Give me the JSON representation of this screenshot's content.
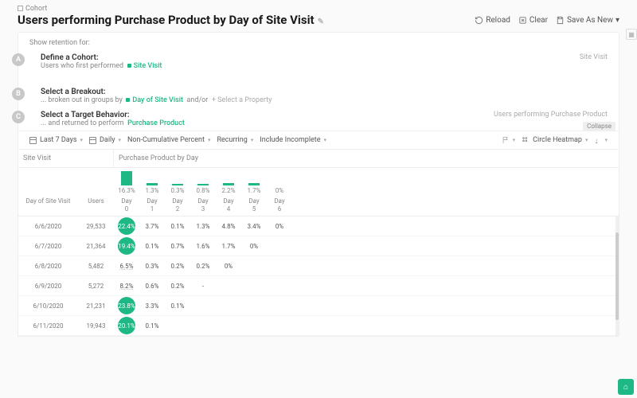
{
  "breadcrumb": {
    "icon": "cohort",
    "label": "Cohort"
  },
  "title": "Users performing Purchase Product by Day of Site Visit",
  "actions": {
    "reload": "Reload",
    "clear": "Clear",
    "save": "Save As New"
  },
  "retention_label": "Show retention for:",
  "steps": {
    "A": {
      "title": "Define a Cohort:",
      "desc": "Users who first performed",
      "token": "Site Visit",
      "right": "Site Visit"
    },
    "B": {
      "title": "Select a Breakout:",
      "prefix": "... broken out in groups by",
      "token": "Day of Site Visit",
      "mid": "and/or",
      "add": "+ Select a Property"
    },
    "C": {
      "title": "Select a Target Behavior:",
      "desc": "... and returned to perform",
      "token": "Purchase Product",
      "right": "Users performing Purchase Product"
    }
  },
  "controls": {
    "range": "Last 7 Days",
    "interval": "Daily",
    "mode": "Non-Cumulative Percent",
    "recurring": "Recurring",
    "incomplete": "Include Incomplete",
    "chart": "Circle Heatmap",
    "collapse": "Collapse"
  },
  "table": {
    "left_header": "Site Visit",
    "right_header": "Purchase Product by Day",
    "col_label": "Day of Site Visit",
    "users_label": "Users",
    "summary": [
      {
        "h": 18,
        "pct": "16.3%"
      },
      {
        "h": 3,
        "pct": "1.3%"
      },
      {
        "h": 2,
        "pct": "0.3%"
      },
      {
        "h": 2,
        "pct": "0.8%"
      },
      {
        "h": 3,
        "pct": "2.2%"
      },
      {
        "h": 3,
        "pct": "1.7%"
      },
      {
        "h": 0,
        "pct": "0%"
      }
    ],
    "day_labels": [
      "Day 0",
      "Day 1",
      "Day 2",
      "Day 3",
      "Day 4",
      "Day 5",
      "Day 6"
    ],
    "rows": [
      {
        "date": "6/6/2020",
        "users": "29,533",
        "cells": [
          {
            "v": "22.4%",
            "big": true
          },
          {
            "v": "3.7%"
          },
          {
            "v": "0.1%"
          },
          {
            "v": "1.3%"
          },
          {
            "v": "4.8%"
          },
          {
            "v": "3.4%"
          },
          {
            "v": "0%"
          }
        ]
      },
      {
        "date": "6/7/2020",
        "users": "21,364",
        "cells": [
          {
            "v": "19.4%",
            "big": true
          },
          {
            "v": "0.1%"
          },
          {
            "v": "0.7%"
          },
          {
            "v": "1.6%"
          },
          {
            "v": "1.7%"
          },
          {
            "v": "0%"
          }
        ]
      },
      {
        "date": "6/8/2020",
        "users": "5,482",
        "cells": [
          {
            "v": "6.5%",
            "ul": true
          },
          {
            "v": "0.3%"
          },
          {
            "v": "0.2%"
          },
          {
            "v": "0.2%"
          },
          {
            "v": "0%"
          }
        ]
      },
      {
        "date": "6/9/2020",
        "users": "5,272",
        "cells": [
          {
            "v": "8.2%",
            "ul": true
          },
          {
            "v": "0.6%"
          },
          {
            "v": "0.2%"
          },
          {
            "v": "-"
          }
        ]
      },
      {
        "date": "6/10/2020",
        "users": "21,231",
        "cells": [
          {
            "v": "23.8%",
            "big": true
          },
          {
            "v": "3.3%"
          },
          {
            "v": "0.1%"
          }
        ]
      },
      {
        "date": "6/11/2020",
        "users": "19,943",
        "cells": [
          {
            "v": "20.1%",
            "big": true
          },
          {
            "v": "0.1%"
          }
        ]
      }
    ]
  }
}
